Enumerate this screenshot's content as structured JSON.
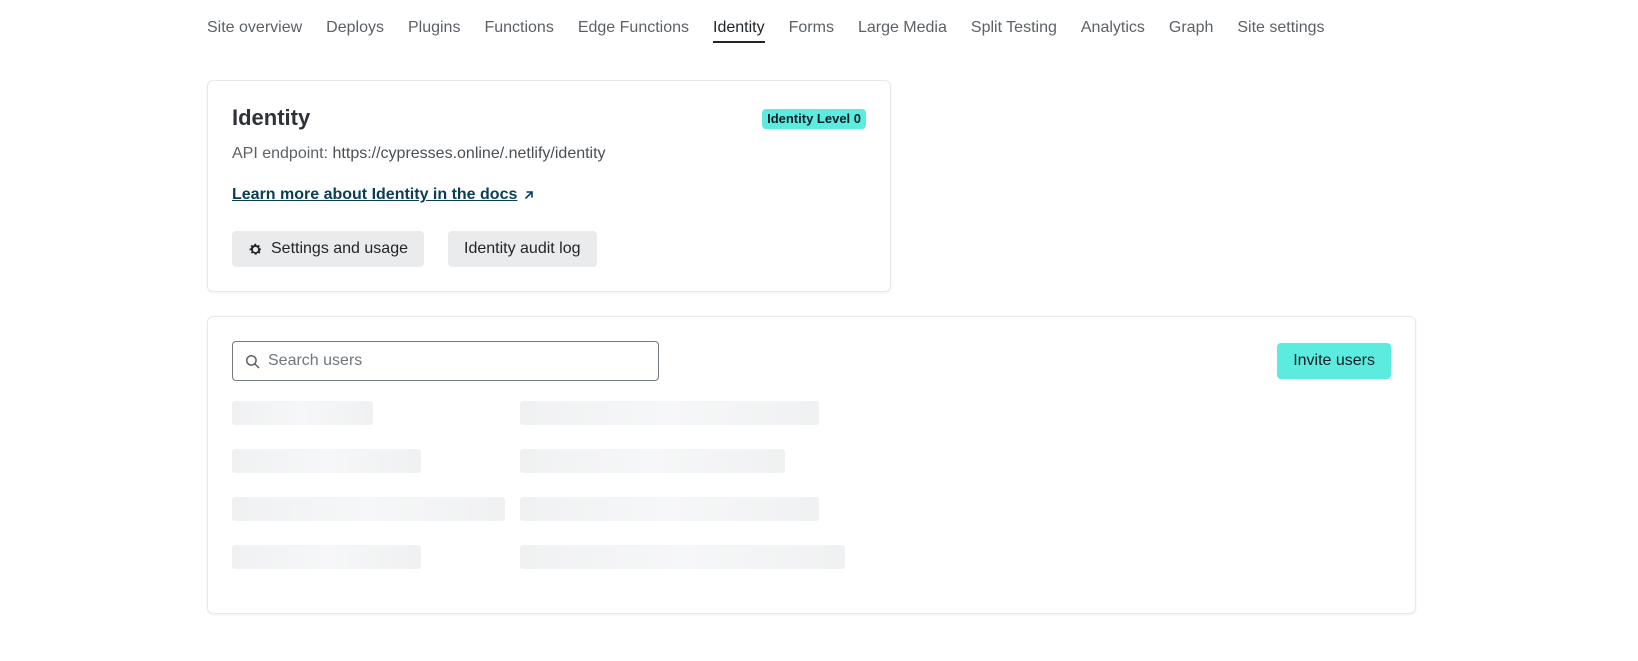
{
  "nav": {
    "items": [
      {
        "label": "Site overview",
        "active": false
      },
      {
        "label": "Deploys",
        "active": false
      },
      {
        "label": "Plugins",
        "active": false
      },
      {
        "label": "Functions",
        "active": false
      },
      {
        "label": "Edge Functions",
        "active": false
      },
      {
        "label": "Identity",
        "active": true
      },
      {
        "label": "Forms",
        "active": false
      },
      {
        "label": "Large Media",
        "active": false
      },
      {
        "label": "Split Testing",
        "active": false
      },
      {
        "label": "Analytics",
        "active": false
      },
      {
        "label": "Graph",
        "active": false
      },
      {
        "label": "Site settings",
        "active": false
      }
    ]
  },
  "identity_card": {
    "title": "Identity",
    "level_badge": "Identity Level 0",
    "api_label": "API endpoint:",
    "api_value": "https://cypresses.online/.netlify/identity",
    "docs_link": "Learn more about Identity in the docs",
    "settings_button": "Settings and usage",
    "audit_button": "Identity audit log"
  },
  "users_card": {
    "search_placeholder": "Search users",
    "search_value": "",
    "invite_button": "Invite users"
  },
  "icons": {
    "docs_link": "external-arrow-icon",
    "settings": "gear-icon",
    "search": "search-icon"
  },
  "colors": {
    "accent": "#5cebdf",
    "link": "#0b3d55",
    "skeleton": "#f0f1f2"
  }
}
